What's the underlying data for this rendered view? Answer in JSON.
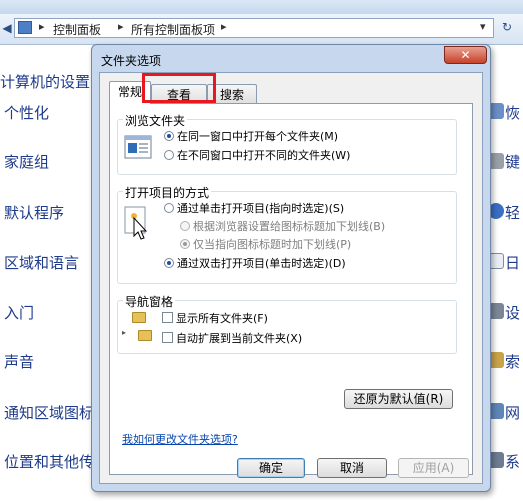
{
  "explorer": {
    "breadcrumb": [
      "控制面板",
      "所有控制面板项"
    ],
    "page_title": "计算机的设置",
    "left_items": [
      "个性化",
      "家庭组",
      "默认程序",
      "区域和语言",
      "入门",
      "声音",
      "通知区域图标",
      "位置和其他传"
    ],
    "right_items": [
      "恢",
      "键",
      "轻",
      "日",
      "设",
      "索",
      "网",
      "系"
    ]
  },
  "dialog": {
    "title": "文件夹选项",
    "close_glyph": "✕",
    "tabs": [
      {
        "label": "常规",
        "active": true
      },
      {
        "label": "查看",
        "active": false
      },
      {
        "label": "搜索",
        "active": false
      }
    ],
    "browse_group": {
      "title": "浏览文件夹",
      "options": [
        {
          "label": "在同一窗口中打开每个文件夹(M)",
          "selected": true
        },
        {
          "label": "在不同窗口中打开不同的文件夹(W)",
          "selected": false
        }
      ]
    },
    "click_group": {
      "title": "打开项目的方式",
      "options": [
        {
          "label": "通过单击打开项目(指向时选定)(S)",
          "selected": false,
          "enabled": true
        },
        {
          "label": "根据浏览器设置给图标标题加下划线(B)",
          "selected": false,
          "enabled": false
        },
        {
          "label": "仅当指向图标标题时加下划线(P)",
          "selected": true,
          "enabled": false
        },
        {
          "label": "通过双击打开项目(单击时选定)(D)",
          "selected": true,
          "enabled": true
        }
      ]
    },
    "nav_group": {
      "title": "导航窗格",
      "options": [
        {
          "label": "显示所有文件夹(F)",
          "checked": false
        },
        {
          "label": "自动扩展到当前文件夹(X)",
          "checked": false
        }
      ]
    },
    "restore_button": "还原为默认值(R)",
    "help_link": "我如何更改文件夹选项?",
    "buttons": {
      "ok": "确定",
      "cancel": "取消",
      "apply": "应用(A)"
    }
  },
  "colors": {
    "highlight_box": "#e8181f",
    "link": "#0645ad",
    "explorer_text": "#1e3a8a"
  }
}
